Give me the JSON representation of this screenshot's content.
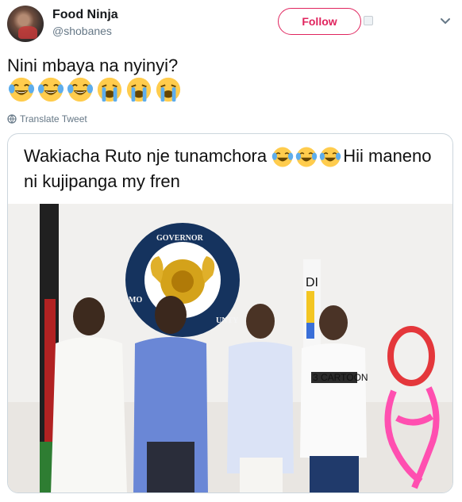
{
  "tweet": {
    "author_name": "Food Ninja",
    "author_handle": "@shobanes",
    "follow_label": "Follow",
    "text": "Nini mbaya na nyinyi?",
    "emojis": [
      "face-with-tears-of-joy",
      "face-with-tears-of-joy",
      "face-with-tears-of-joy",
      "loudly-crying-face",
      "loudly-crying-face",
      "loudly-crying-face"
    ],
    "translate_label": "Translate Tweet"
  },
  "media": {
    "caption_part1": "Wakiacha Ruto nje tunamchora ",
    "caption_emojis": [
      "face-with-tears-of-joy",
      "face-with-tears-of-joy",
      "face-with-tears-of-joy"
    ],
    "caption_part2": "Hii maneno ni kujipanga my fren",
    "seal_top": "GOVERNOR",
    "seal_left": "MO",
    "seal_right": "UNTY",
    "tshirt_text": "3 CARTOON"
  },
  "colors": {
    "follow_accent": "#e0245e",
    "muted": "#657786",
    "text": "#14171a",
    "drawing_red": "#e4373b",
    "drawing_pink": "#ff4fb0",
    "seal_blue": "#15335e"
  }
}
